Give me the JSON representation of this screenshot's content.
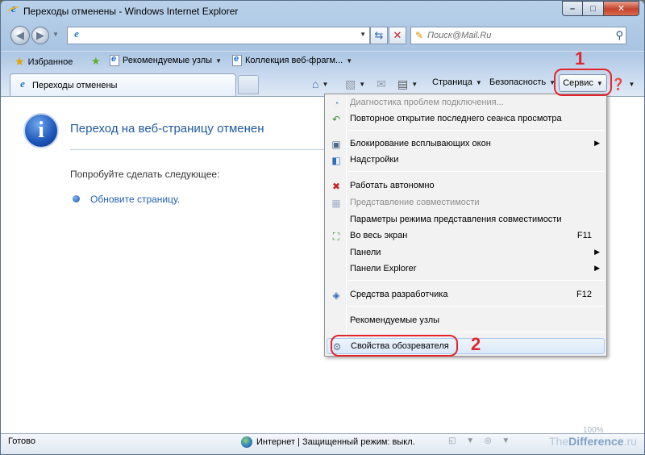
{
  "window": {
    "title": "Переходы отменены - Windows Internet Explorer",
    "caption": {
      "minimize": "–",
      "maximize": "□",
      "close": "✕"
    }
  },
  "address_bar": {
    "value": "",
    "search_placeholder": "Поиск@Mail.Ru"
  },
  "favorites_bar": {
    "favorites_label": "Избранное",
    "items": [
      "Рекомендуемые узлы",
      "Коллекция веб-фрагм..."
    ]
  },
  "tab": {
    "label": "Переходы отменены"
  },
  "command_bar": {
    "page": "Страница",
    "safety": "Безопасность",
    "tools": "Сервис"
  },
  "page": {
    "heading": "Переход на веб-страницу отменен",
    "try_text": "Попробуйте сделать следующее:",
    "refresh_link": "Обновите страницу."
  },
  "menu": {
    "items": [
      {
        "label": "Диагностика проблем подключения...",
        "disabled": true,
        "icon": "diagnostics-icon"
      },
      {
        "label": "Повторное открытие последнего сеанса просмотра",
        "icon": "reopen-session-icon"
      },
      {
        "label": "Блокирование всплывающих окон",
        "submenu": true,
        "icon": "popup-blocker-icon"
      },
      {
        "label": "Надстройки",
        "icon": "addons-icon"
      },
      {
        "label": "Работать автономно",
        "icon": "offline-icon"
      },
      {
        "label": "Представление совместимости",
        "disabled": true,
        "icon": "compatibility-icon"
      },
      {
        "label": "Параметры режима представления совместимости"
      },
      {
        "label": "Во весь экран",
        "shortcut": "F11",
        "icon": "fullscreen-icon"
      },
      {
        "label": "Панели",
        "submenu": true
      },
      {
        "label": "Панели Explorer",
        "submenu": true
      },
      {
        "label": "Средства разработчика",
        "shortcut": "F12",
        "icon": "developer-tools-icon"
      },
      {
        "label": "Рекомендуемые узлы"
      },
      {
        "label": "Свойства обозревателя",
        "icon": "internet-options-icon"
      }
    ]
  },
  "annotations": {
    "step1": "1",
    "step2": "2"
  },
  "status_bar": {
    "ready": "Готово",
    "zone": "Интернет | Защищенный режим: выкл.",
    "zoom": "100%"
  },
  "watermark": {
    "prefix": "The",
    "bold": "Difference",
    "suffix": ".ru"
  },
  "colors": {
    "accent_red": "#e0262b",
    "link_blue": "#1f5fae"
  }
}
